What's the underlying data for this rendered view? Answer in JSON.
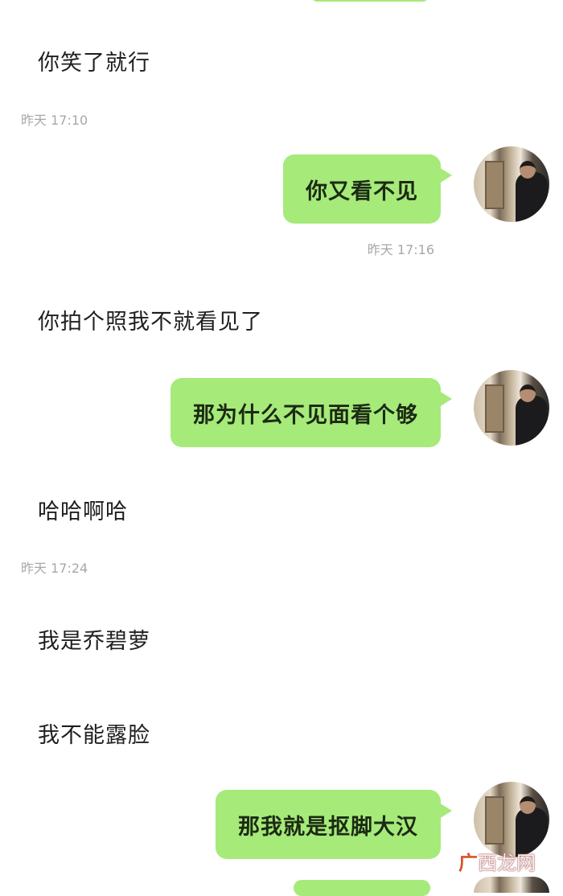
{
  "messages": [
    {
      "side": "left",
      "text": "你笑了就行"
    },
    {
      "side": "time",
      "text": "昨天 17:10"
    },
    {
      "side": "right",
      "text": "你又看不见"
    },
    {
      "side": "time",
      "text": "昨天 17:16"
    },
    {
      "side": "left",
      "text": "你拍个照我不就看见了"
    },
    {
      "side": "right",
      "text": "那为什么不见面看个够"
    },
    {
      "side": "left",
      "text": "哈哈啊哈"
    },
    {
      "side": "time",
      "text": "昨天 17:24"
    },
    {
      "side": "left",
      "text": "我是乔碧萝"
    },
    {
      "side": "left",
      "text": "我不能露脸"
    },
    {
      "side": "right",
      "text": "那我就是抠脚大汉"
    }
  ],
  "watermark": {
    "text": "西龙网"
  },
  "colors": {
    "bubble_green": "#a6ea7a",
    "background": "#ffffff",
    "timestamp": "#a8a8a8"
  },
  "icons": {
    "avatar": "user-avatar-photo",
    "watermark_icon": "guang-logo-icon"
  }
}
